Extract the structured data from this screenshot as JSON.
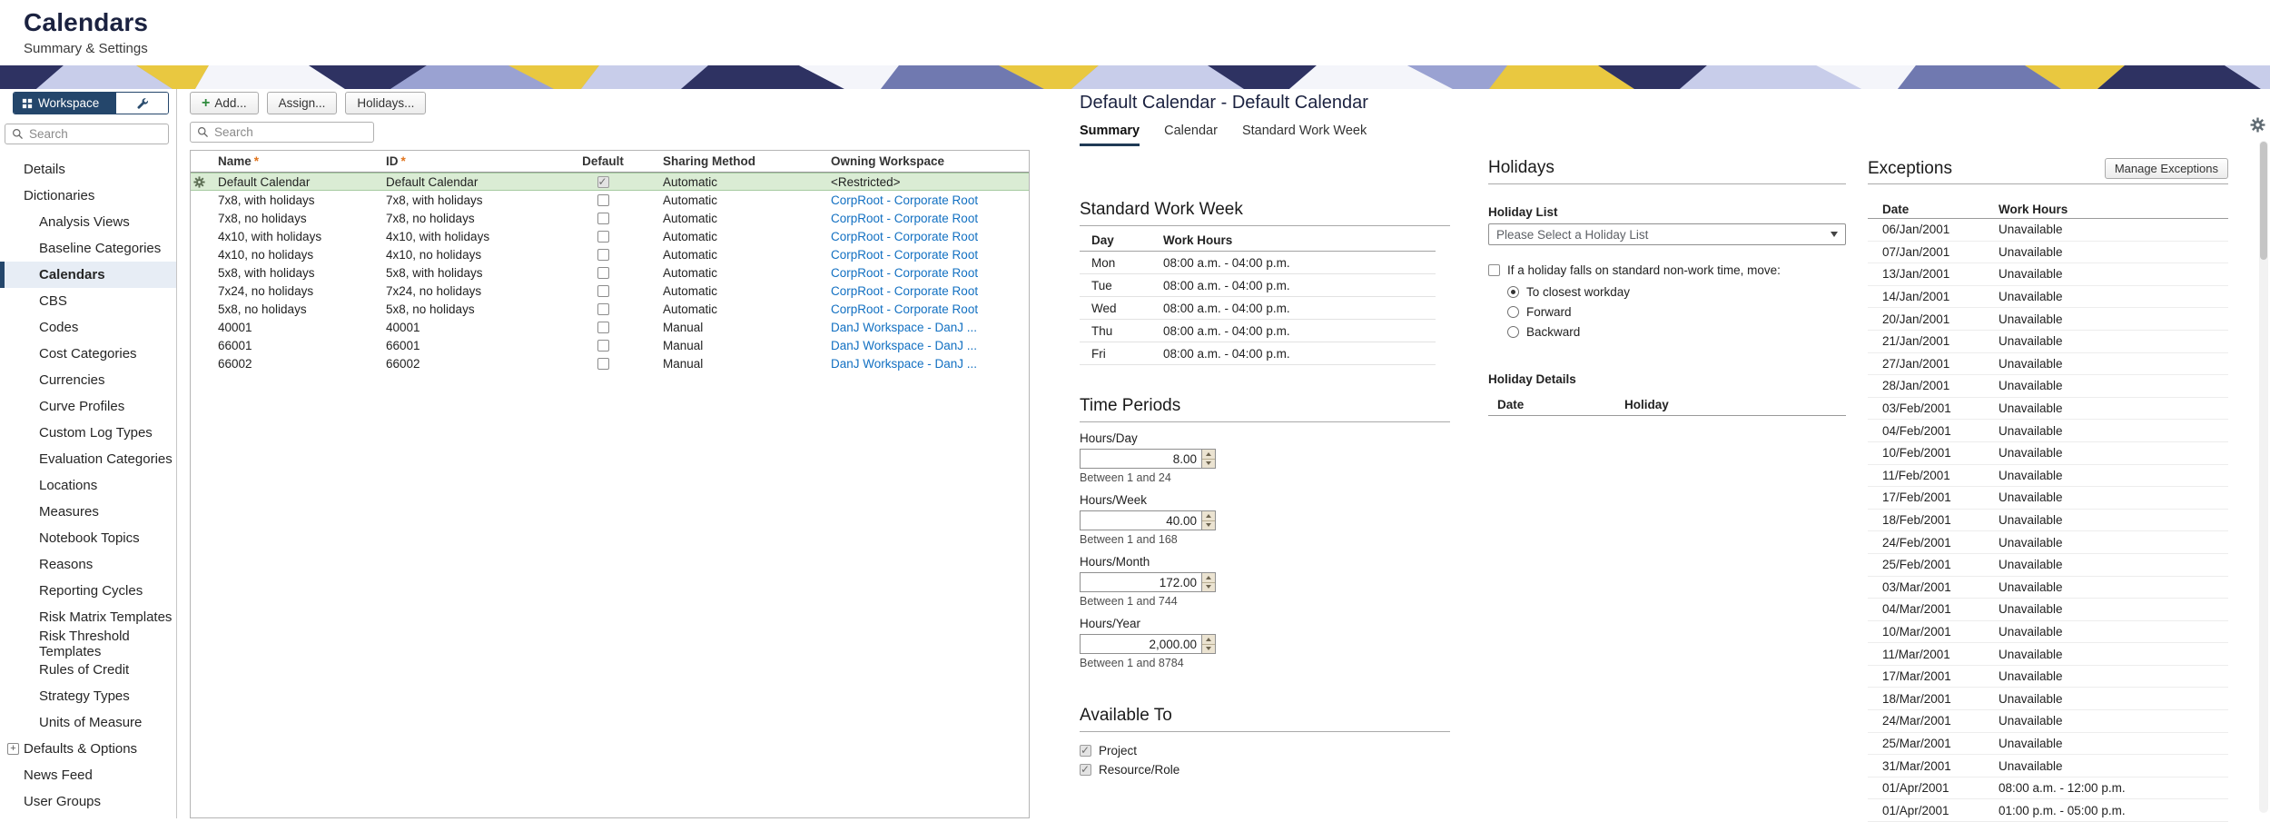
{
  "header": {
    "title": "Calendars",
    "subtitle": "Summary & Settings"
  },
  "sidebar": {
    "workspace_button_label": "Workspace",
    "search_placeholder": "Search",
    "items": [
      {
        "label": "Details",
        "level": 1
      },
      {
        "label": "Dictionaries",
        "level": 1
      },
      {
        "label": "Analysis Views",
        "level": 2
      },
      {
        "label": "Baseline Categories",
        "level": 2
      },
      {
        "label": "Calendars",
        "level": 2,
        "selected": true
      },
      {
        "label": "CBS",
        "level": 2
      },
      {
        "label": "Codes",
        "level": 2
      },
      {
        "label": "Cost Categories",
        "level": 2
      },
      {
        "label": "Currencies",
        "level": 2
      },
      {
        "label": "Curve Profiles",
        "level": 2
      },
      {
        "label": "Custom Log Types",
        "level": 2
      },
      {
        "label": "Evaluation Categories",
        "level": 2
      },
      {
        "label": "Locations",
        "level": 2
      },
      {
        "label": "Measures",
        "level": 2
      },
      {
        "label": "Notebook Topics",
        "level": 2
      },
      {
        "label": "Reasons",
        "level": 2
      },
      {
        "label": "Reporting Cycles",
        "level": 2
      },
      {
        "label": "Risk Matrix Templates",
        "level": 2
      },
      {
        "label": "Risk Threshold Templates",
        "level": 2
      },
      {
        "label": "Rules of Credit",
        "level": 2
      },
      {
        "label": "Strategy Types",
        "level": 2
      },
      {
        "label": "Units of Measure",
        "level": 2
      },
      {
        "label": "Defaults & Options",
        "level": 1,
        "expandable": true
      },
      {
        "label": "News Feed",
        "level": 1
      },
      {
        "label": "User Groups",
        "level": 1
      }
    ]
  },
  "toolbar": {
    "add_label": "Add...",
    "assign_label": "Assign...",
    "holidays_label": "Holidays...",
    "search_placeholder": "Search"
  },
  "calendar_table": {
    "required_marker": "*",
    "columns": {
      "name": "Name",
      "id": "ID",
      "default": "Default",
      "sharing": "Sharing Method",
      "owning": "Owning Workspace"
    },
    "rows": [
      {
        "name": "Default Calendar",
        "id": "Default Calendar",
        "default_checked": true,
        "sharing": "Automatic",
        "owning": "<Restricted>",
        "owning_link": false,
        "selected": true
      },
      {
        "name": "7x8, with holidays",
        "id": "7x8, with holidays",
        "default_checked": false,
        "sharing": "Automatic",
        "owning": "CorpRoot - Corporate Root",
        "owning_link": true,
        "selected": false
      },
      {
        "name": "7x8, no holidays",
        "id": "7x8, no holidays",
        "default_checked": false,
        "sharing": "Automatic",
        "owning": "CorpRoot - Corporate Root",
        "owning_link": true,
        "selected": false
      },
      {
        "name": "4x10, with holidays",
        "id": "4x10, with holidays",
        "default_checked": false,
        "sharing": "Automatic",
        "owning": "CorpRoot - Corporate Root",
        "owning_link": true,
        "selected": false
      },
      {
        "name": "4x10, no holidays",
        "id": "4x10, no holidays",
        "default_checked": false,
        "sharing": "Automatic",
        "owning": "CorpRoot - Corporate Root",
        "owning_link": true,
        "selected": false
      },
      {
        "name": "5x8, with holidays",
        "id": "5x8, with holidays",
        "default_checked": false,
        "sharing": "Automatic",
        "owning": "CorpRoot - Corporate Root",
        "owning_link": true,
        "selected": false
      },
      {
        "name": "7x24, no holidays",
        "id": "7x24, no holidays",
        "default_checked": false,
        "sharing": "Automatic",
        "owning": "CorpRoot - Corporate Root",
        "owning_link": true,
        "selected": false
      },
      {
        "name": "5x8, no holidays",
        "id": "5x8, no holidays",
        "default_checked": false,
        "sharing": "Automatic",
        "owning": "CorpRoot - Corporate Root",
        "owning_link": true,
        "selected": false
      },
      {
        "name": "40001",
        "id": "40001",
        "default_checked": false,
        "sharing": "Manual",
        "owning": "DanJ Workspace - DanJ ...",
        "owning_link": true,
        "selected": false
      },
      {
        "name": "66001",
        "id": "66001",
        "default_checked": false,
        "sharing": "Manual",
        "owning": "DanJ Workspace - DanJ ...",
        "owning_link": true,
        "selected": false
      },
      {
        "name": "66002",
        "id": "66002",
        "default_checked": false,
        "sharing": "Manual",
        "owning": "DanJ Workspace - DanJ ...",
        "owning_link": true,
        "selected": false
      }
    ]
  },
  "detail": {
    "title": "Default Calendar - Default Calendar",
    "tabs": [
      {
        "label": "Summary",
        "active": true
      },
      {
        "label": "Calendar",
        "active": false
      },
      {
        "label": "Standard Work Week",
        "active": false
      }
    ],
    "standard_work_week": {
      "heading": "Standard Work Week",
      "day_col": "Day",
      "hours_col": "Work Hours",
      "rows": [
        {
          "day": "Mon",
          "hours": "08:00 a.m. - 04:00 p.m."
        },
        {
          "day": "Tue",
          "hours": "08:00 a.m. - 04:00 p.m."
        },
        {
          "day": "Wed",
          "hours": "08:00 a.m. - 04:00 p.m."
        },
        {
          "day": "Thu",
          "hours": "08:00 a.m. - 04:00 p.m."
        },
        {
          "day": "Fri",
          "hours": "08:00 a.m. - 04:00 p.m."
        }
      ]
    },
    "time_periods": {
      "heading": "Time Periods",
      "fields": [
        {
          "label": "Hours/Day",
          "value": "8.00",
          "hint": "Between 1 and 24"
        },
        {
          "label": "Hours/Week",
          "value": "40.00",
          "hint": "Between 1 and 168"
        },
        {
          "label": "Hours/Month",
          "value": "172.00",
          "hint": "Between 1 and 744"
        },
        {
          "label": "Hours/Year",
          "value": "2,000.00",
          "hint": "Between 1 and 8784"
        }
      ]
    },
    "available_to": {
      "heading": "Available To",
      "options": [
        {
          "label": "Project",
          "checked": true
        },
        {
          "label": "Resource/Role",
          "checked": true
        }
      ]
    },
    "holidays": {
      "heading": "Holidays",
      "list_label": "Holiday List",
      "dropdown_value": "Please Select a Holiday List",
      "move_label": "If a holiday falls on standard non-work time, move:",
      "move_checked": false,
      "radios": [
        {
          "label": "To closest workday",
          "selected": true
        },
        {
          "label": "Forward",
          "selected": false
        },
        {
          "label": "Backward",
          "selected": false
        }
      ],
      "details_label": "Holiday Details",
      "date_col": "Date",
      "holiday_col": "Holiday"
    },
    "exceptions": {
      "heading": "Exceptions",
      "manage_button": "Manage Exceptions",
      "date_col": "Date",
      "hours_col": "Work Hours",
      "rows": [
        {
          "date": "06/Jan/2001",
          "hours": "Unavailable"
        },
        {
          "date": "07/Jan/2001",
          "hours": "Unavailable"
        },
        {
          "date": "13/Jan/2001",
          "hours": "Unavailable"
        },
        {
          "date": "14/Jan/2001",
          "hours": "Unavailable"
        },
        {
          "date": "20/Jan/2001",
          "hours": "Unavailable"
        },
        {
          "date": "21/Jan/2001",
          "hours": "Unavailable"
        },
        {
          "date": "27/Jan/2001",
          "hours": "Unavailable"
        },
        {
          "date": "28/Jan/2001",
          "hours": "Unavailable"
        },
        {
          "date": "03/Feb/2001",
          "hours": "Unavailable"
        },
        {
          "date": "04/Feb/2001",
          "hours": "Unavailable"
        },
        {
          "date": "10/Feb/2001",
          "hours": "Unavailable"
        },
        {
          "date": "11/Feb/2001",
          "hours": "Unavailable"
        },
        {
          "date": "17/Feb/2001",
          "hours": "Unavailable"
        },
        {
          "date": "18/Feb/2001",
          "hours": "Unavailable"
        },
        {
          "date": "24/Feb/2001",
          "hours": "Unavailable"
        },
        {
          "date": "25/Feb/2001",
          "hours": "Unavailable"
        },
        {
          "date": "03/Mar/2001",
          "hours": "Unavailable"
        },
        {
          "date": "04/Mar/2001",
          "hours": "Unavailable"
        },
        {
          "date": "10/Mar/2001",
          "hours": "Unavailable"
        },
        {
          "date": "11/Mar/2001",
          "hours": "Unavailable"
        },
        {
          "date": "17/Mar/2001",
          "hours": "Unavailable"
        },
        {
          "date": "18/Mar/2001",
          "hours": "Unavailable"
        },
        {
          "date": "24/Mar/2001",
          "hours": "Unavailable"
        },
        {
          "date": "25/Mar/2001",
          "hours": "Unavailable"
        },
        {
          "date": "31/Mar/2001",
          "hours": "Unavailable"
        },
        {
          "date": "01/Apr/2001",
          "hours": "08:00 a.m. - 12:00 p.m."
        },
        {
          "date": "01/Apr/2001",
          "hours": "01:00 p.m. - 05:00 p.m."
        }
      ]
    }
  }
}
